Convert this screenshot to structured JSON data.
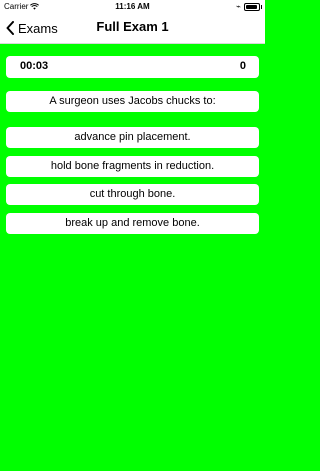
{
  "status_bar": {
    "carrier": "Carrier",
    "time": "11:16 AM",
    "battery_level": 0.9
  },
  "nav": {
    "back_label": "Exams",
    "title": "Full Exam 1"
  },
  "exam": {
    "timer": "00:03",
    "score": "0",
    "question": "A surgeon uses Jacobs chucks to:",
    "answers": [
      "advance pin placement.",
      "hold bone fragments in reduction.",
      "cut through bone.",
      "break up and remove bone."
    ]
  },
  "colors": {
    "background": "#00ff00",
    "card": "#ffffff"
  }
}
